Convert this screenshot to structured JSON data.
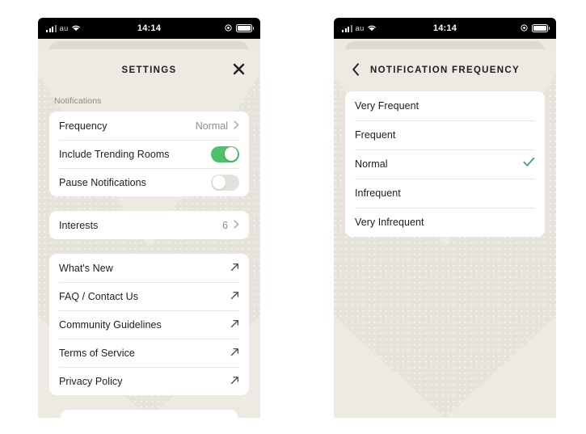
{
  "theme": {
    "accent_green": "#4ec16a",
    "check_green": "#39a251",
    "sheet_bg": "#edeae3",
    "card_bg": "#ffffff",
    "text_primary": "#1d1d1b",
    "text_muted": "#8f8d87",
    "status_bar_bg": "#000000"
  },
  "status_bar": {
    "carrier": "au",
    "time": "14:14",
    "signal_icon": "signal-bars-icon",
    "wifi_icon": "wifi-icon",
    "alarm_icon": "alarm-icon",
    "battery_icon": "battery-icon"
  },
  "screen_settings": {
    "nav": {
      "title": "SETTINGS",
      "close_icon": "close-icon"
    },
    "sections": [
      {
        "label": "Notifications",
        "rows": [
          {
            "label": "Frequency",
            "value": "Normal",
            "type": "disclosure",
            "icon": "chevron-right-icon"
          },
          {
            "label": "Include Trending Rooms",
            "type": "toggle",
            "state": "on"
          },
          {
            "label": "Pause Notifications",
            "type": "toggle",
            "state": "off"
          }
        ]
      },
      {
        "label": "",
        "rows": [
          {
            "label": "Interests",
            "value": "6",
            "type": "disclosure",
            "icon": "chevron-right-icon"
          }
        ]
      },
      {
        "label": "",
        "rows": [
          {
            "label": "What's New",
            "type": "external",
            "icon": "external-link-icon"
          },
          {
            "label": "FAQ / Contact Us",
            "type": "external",
            "icon": "external-link-icon"
          },
          {
            "label": "Community Guidelines",
            "type": "external",
            "icon": "external-link-icon"
          },
          {
            "label": "Terms of Service",
            "type": "external",
            "icon": "external-link-icon"
          },
          {
            "label": "Privacy Policy",
            "type": "external",
            "icon": "external-link-icon"
          }
        ]
      }
    ]
  },
  "screen_frequency": {
    "nav": {
      "title": "NOTIFICATION FREQUENCY",
      "back_icon": "chevron-left-icon"
    },
    "options": [
      {
        "label": "Very Frequent",
        "selected": false
      },
      {
        "label": "Frequent",
        "selected": false
      },
      {
        "label": "Normal",
        "selected": true,
        "icon": "checkmark-icon"
      },
      {
        "label": "Infrequent",
        "selected": false
      },
      {
        "label": "Very Infrequent",
        "selected": false
      }
    ]
  }
}
